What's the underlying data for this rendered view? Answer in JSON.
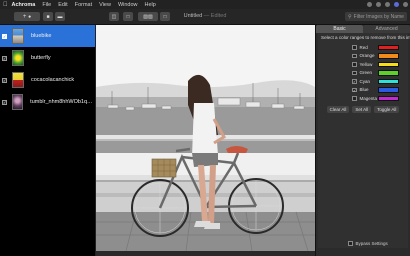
{
  "menubar": {
    "app_name": "Achroma",
    "items": [
      "File",
      "Edit",
      "Format",
      "View",
      "Window",
      "Help"
    ]
  },
  "window": {
    "title": "Untitled",
    "edited": "— Edited"
  },
  "search": {
    "placeholder": "Filter Images by Name"
  },
  "sidebar": {
    "items": [
      {
        "label": "bluebike",
        "selected": true,
        "checked": true
      },
      {
        "label": "butterfly",
        "selected": false,
        "checked": true
      },
      {
        "label": "cocacolacanchick",
        "selected": false,
        "checked": true
      },
      {
        "label": "tumblr_nhm8hhWOb1qahe...",
        "selected": false,
        "checked": true
      }
    ]
  },
  "panel": {
    "tabs": [
      "Basic",
      "Advanced"
    ],
    "prompt": "Select a color ranges to remove from this image:",
    "colors": [
      {
        "name": "Red",
        "hex": "#e02020",
        "checked": false
      },
      {
        "name": "Orange",
        "hex": "#f08a1a",
        "checked": false
      },
      {
        "name": "Yellow",
        "hex": "#f4e01a",
        "checked": false
      },
      {
        "name": "Green",
        "hex": "#5fd02a",
        "checked": false
      },
      {
        "name": "Cyan",
        "hex": "#2de0d8",
        "checked": true
      },
      {
        "name": "Blue",
        "hex": "#2a5be0",
        "checked": true
      },
      {
        "name": "Magenta",
        "hex": "#c02ad0",
        "checked": false
      }
    ],
    "buttons": {
      "clear_all": "Clear All",
      "set_all": "Set All",
      "toggle_all": "Toggle All"
    },
    "bypass_label": "Bypass Settings"
  },
  "colors": {
    "selection": "#2a72d8",
    "bike_accent": "#c8553d"
  }
}
